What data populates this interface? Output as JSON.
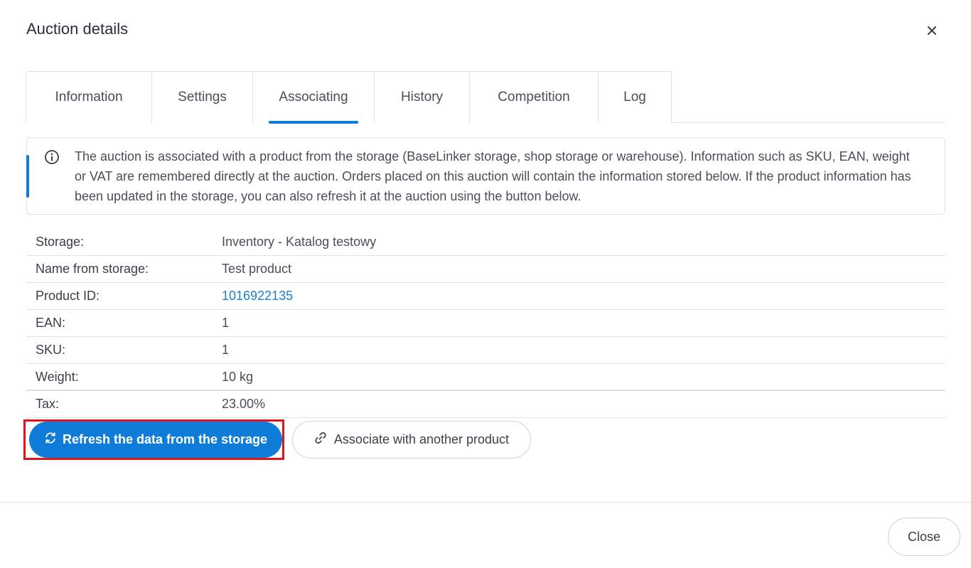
{
  "modal": {
    "title": "Auction details",
    "close_icon": "close-icon"
  },
  "tabs": [
    {
      "label": "Information",
      "active": false
    },
    {
      "label": "Settings",
      "active": false
    },
    {
      "label": "Associating",
      "active": true
    },
    {
      "label": "History",
      "active": false
    },
    {
      "label": "Competition",
      "active": false
    },
    {
      "label": "Log",
      "active": false
    }
  ],
  "info": {
    "icon": "info-icon",
    "text": "The auction is associated with a product from the storage (BaseLinker storage, shop storage or warehouse). Information such as SKU, EAN, weight or VAT are remembered directly at the auction. Orders placed on this auction will contain the information stored below. If the product information has been updated in the storage, you can also refresh it at the auction using the button below."
  },
  "details": [
    {
      "label": "Storage:",
      "value": "Inventory - Katalog testowy"
    },
    {
      "label": "Name from storage:",
      "value": "Test product"
    },
    {
      "label": "Product ID:",
      "value": "1016922135"
    },
    {
      "label": "EAN:",
      "value": "1"
    },
    {
      "label": "SKU:",
      "value": "1"
    },
    {
      "label": "Weight:",
      "value": "10 kg"
    },
    {
      "label": "Tax:",
      "value": "23.00%"
    }
  ],
  "actions": {
    "refresh_label": "Refresh the data from the storage",
    "refresh_icon": "refresh-icon",
    "associate_label": "Associate with another product",
    "associate_icon": "link-icon"
  },
  "footer": {
    "close_label": "Close"
  },
  "colors": {
    "accent": "#0f7cd8",
    "highlight_frame": "#e1141b",
    "link": "#1a80d4"
  }
}
